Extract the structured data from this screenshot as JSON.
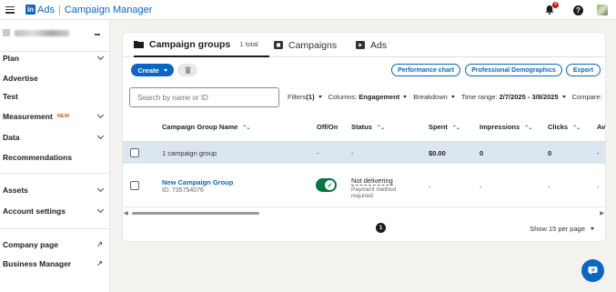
{
  "header": {
    "brand_ads": "Ads",
    "brand_app": "Campaign Manager",
    "notification_count": "4"
  },
  "sidebar": {
    "items": [
      {
        "label": "Plan",
        "chevron": true
      },
      {
        "label": "Advertise"
      },
      {
        "label": "Test"
      },
      {
        "label": "Measurement",
        "badge": "NEW",
        "chevron": true
      },
      {
        "label": "Data",
        "chevron": true
      },
      {
        "label": "Recommendations"
      },
      {
        "label": "Assets",
        "chevron": true
      },
      {
        "label": "Account settings",
        "chevron": true
      },
      {
        "label": "Company page",
        "external": true
      },
      {
        "label": "Business Manager",
        "external": true
      }
    ]
  },
  "tabs": [
    {
      "label": "Campaign groups",
      "count": "1 total",
      "active": true
    },
    {
      "label": "Campaigns"
    },
    {
      "label": "Ads"
    }
  ],
  "toolbar": {
    "create_label": "Create",
    "performance_chart": "Performance chart",
    "professional_demographics": "Professional Demographics",
    "export": "Export"
  },
  "search": {
    "placeholder": "Search by name or ID"
  },
  "filters": {
    "filters_label": "Filters",
    "filters_count": "(1)",
    "columns_label": "Columns:",
    "columns_value": "Engagement",
    "breakdown_label": "Breakdown",
    "timerange_label": "Time range:",
    "timerange_value": "2/7/2025 - 3/8/2025",
    "compare_label": "Compare:"
  },
  "table": {
    "headers": [
      "Campaign Group Name",
      "Off/On",
      "Status",
      "Spent",
      "Impressions",
      "Clicks",
      "Av"
    ],
    "summary": {
      "name": "1 campaign group",
      "onoff": "-",
      "status": "-",
      "spent": "$0.00",
      "impressions": "0",
      "clicks": "0",
      "av": "-"
    },
    "rows": [
      {
        "name": "New Campaign Group",
        "id": "ID: 735754076",
        "status": "Not delivering",
        "status_detail_1": "Payment method",
        "status_detail_2": "required",
        "spent": "-",
        "impressions": "-",
        "clicks": "-",
        "av": "-"
      }
    ]
  },
  "pagination": {
    "page": "1",
    "per_page": "Show 15 per page"
  },
  "colors": {
    "accent": "#0a66c2",
    "toggle_on": "#057642",
    "summary_bg": "#dce6f1"
  }
}
